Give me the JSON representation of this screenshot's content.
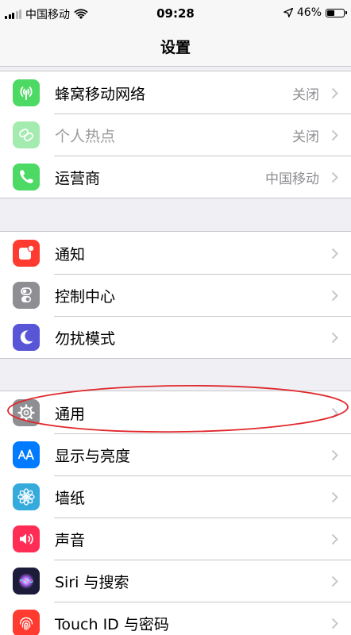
{
  "status_bar": {
    "carrier": "中国移动",
    "time": "09:28",
    "battery_percent": "46%",
    "battery_level": 0.46
  },
  "nav": {
    "title": "设置"
  },
  "groups": [
    {
      "rows": [
        {
          "label": "蜂窝移动网络",
          "value": "关闭",
          "icon": "cellular-antenna-icon",
          "color": "#4cd964"
        },
        {
          "label": "个人热点",
          "value": "关闭",
          "icon": "hotspot-chain-icon",
          "color": "#4cd964",
          "disabled": true
        },
        {
          "label": "运营商",
          "value": "中国移动",
          "icon": "phone-icon",
          "color": "#4cd964"
        }
      ]
    },
    {
      "rows": [
        {
          "label": "通知",
          "value": "",
          "icon": "notification-icon",
          "color": "#ff3b30"
        },
        {
          "label": "控制中心",
          "value": "",
          "icon": "toggles-icon",
          "color": "#8e8e93"
        },
        {
          "label": "勿扰模式",
          "value": "",
          "icon": "moon-icon",
          "color": "#5856d6"
        }
      ]
    },
    {
      "rows": [
        {
          "label": "通用",
          "value": "",
          "icon": "gear-icon",
          "color": "#8e8e93"
        },
        {
          "label": "显示与亮度",
          "value": "",
          "icon": "text-size-icon",
          "color": "#007aff"
        },
        {
          "label": "墙纸",
          "value": "",
          "icon": "flower-icon",
          "color": "#35aadc"
        },
        {
          "label": "声音",
          "value": "",
          "icon": "speaker-icon",
          "color": "#ff2d55"
        },
        {
          "label": "Siri 与搜索",
          "value": "",
          "icon": "siri-icon",
          "color": "#1c1c3a"
        },
        {
          "label": "Touch ID 与密码",
          "value": "",
          "icon": "fingerprint-icon",
          "color": "#ff3b30"
        }
      ]
    }
  ],
  "annotation": {
    "highlight_color": "#e0282c"
  }
}
